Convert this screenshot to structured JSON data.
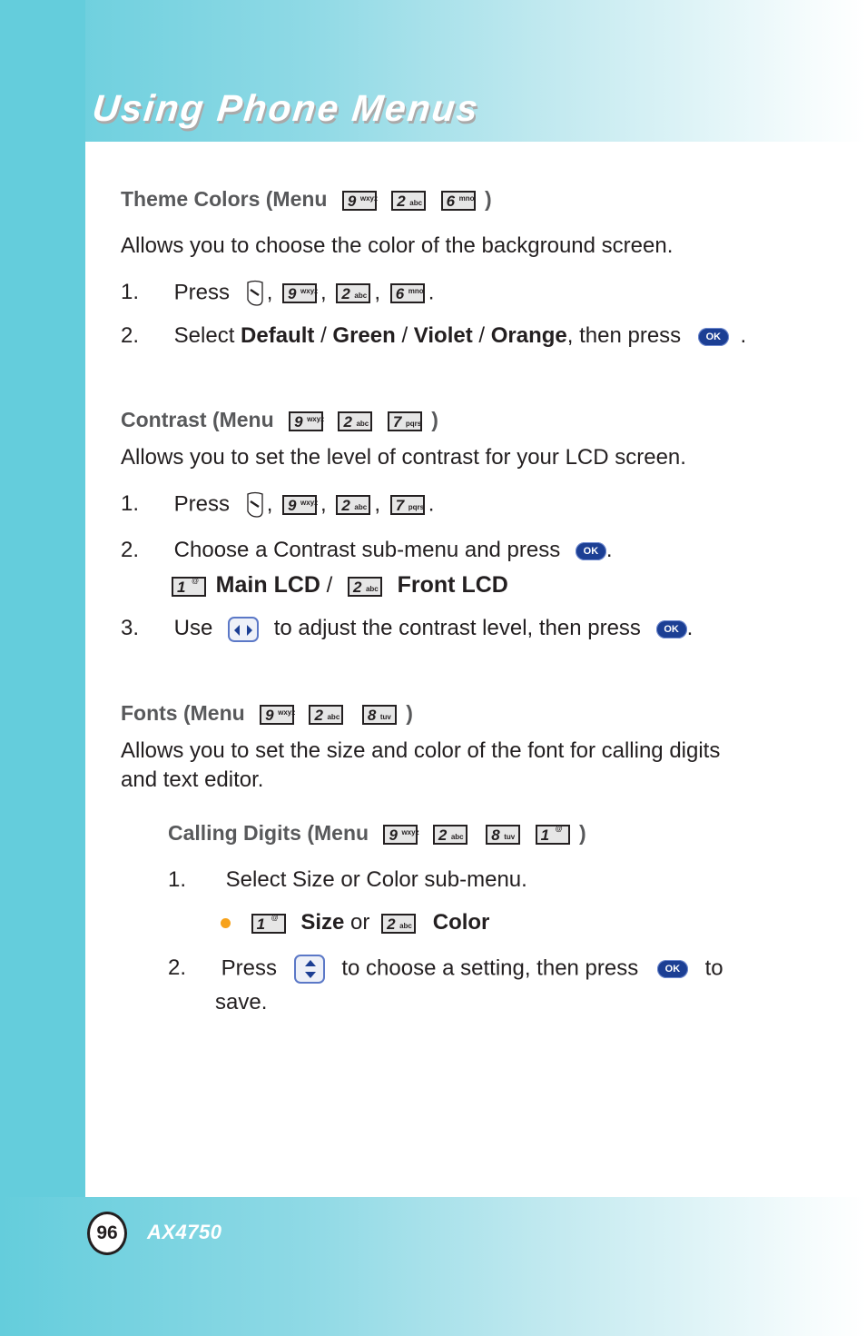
{
  "header": {
    "title": "Using Phone Menus"
  },
  "colors": {
    "header_teal": "#64cddc",
    "ok_button_blue": "#1c3f94",
    "bullet_orange": "#f7a21b",
    "heading_gray": "#58595b"
  },
  "keys": {
    "k1": {
      "digit": "1",
      "letters": "@"
    },
    "k2": {
      "digit": "2",
      "letters": "abc"
    },
    "k6": {
      "digit": "6",
      "letters": "mno"
    },
    "k7": {
      "digit": "7",
      "letters": "pqrs"
    },
    "k8": {
      "digit": "8",
      "letters": "tuv"
    },
    "k9": {
      "digit": "9",
      "letters": "wxyz"
    },
    "ok": "OK"
  },
  "punct": {
    "comma": ",",
    "period": ".",
    "close_paren": ")",
    "slash": "/"
  },
  "theme_colors": {
    "heading": "Theme Colors (Menu",
    "description": "Allows you to choose the color of the background screen.",
    "step1_num": "1.",
    "step1_text": "Press",
    "step2_num": "2.",
    "step2_prefix": "Select",
    "options": [
      "Default",
      "Green",
      "Violet",
      "Orange"
    ],
    "step2_suffix": ", then press"
  },
  "contrast": {
    "heading": "Contrast (Menu",
    "description": "Allows you to set the level of contrast for your LCD screen.",
    "step1_num": "1.",
    "step1_text": "Press",
    "step2_num": "2.",
    "step2_text": "Choose a Contrast sub-menu and press",
    "sub_options": [
      "Main LCD",
      "Front LCD"
    ],
    "step3_num": "3.",
    "step3_prefix": "Use",
    "step3_suffix": "to adjust the contrast level, then press"
  },
  "fonts": {
    "heading": "Fonts (Menu",
    "description_line1": "Allows you to set the size and color of the font for calling digits",
    "description_line2": "and text editor.",
    "calling_digits": {
      "heading": "Calling Digits (Menu",
      "step1_num": "1.",
      "step1_text": "Select Size or Color sub-menu.",
      "bullet_opt1": "Size",
      "bullet_or": "or",
      "bullet_opt2": "Color",
      "step2_num": "2.",
      "step2_prefix": "Press",
      "step2_middle": "to choose a setting, then press",
      "step2_suffix": "to",
      "step2_line2": "save."
    }
  },
  "footer": {
    "page_number": "96",
    "model": "AX4750"
  }
}
